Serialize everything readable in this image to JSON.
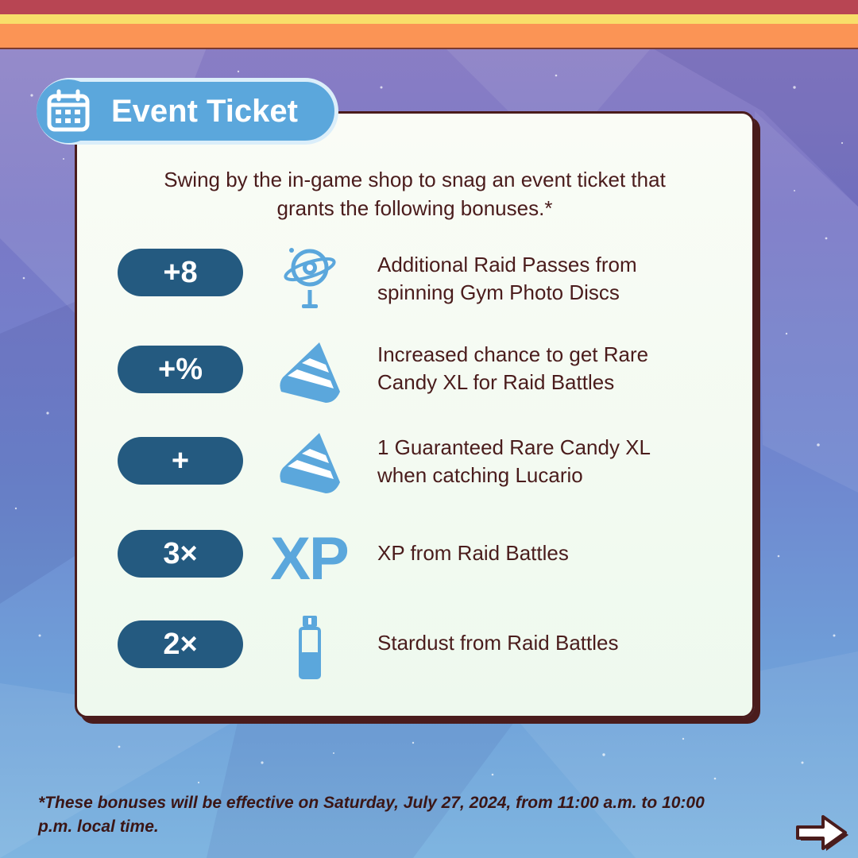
{
  "header": {
    "title": "Event Ticket",
    "icon": "calendar-icon"
  },
  "intro_text": "Swing by the in-game shop to snag an event ticket that grants the following bonuses.*",
  "bonuses": [
    {
      "value": "+8",
      "icon": "raid-pass-icon",
      "text": "Additional Raid Passes from spinning Gym Photo Discs"
    },
    {
      "value": "+%",
      "icon": "rare-candy-xl-icon",
      "text": "Increased chance to get Rare Candy XL for Raid Battles"
    },
    {
      "value": "+",
      "icon": "rare-candy-xl-icon",
      "text": "1 Guaranteed Rare Candy XL when catching Lucario"
    },
    {
      "value": "3×",
      "icon": "xp-icon",
      "icon_label": "XP",
      "text": "XP from Raid Battles"
    },
    {
      "value": "2×",
      "icon": "stardust-icon",
      "text": "Stardust from Raid Battles"
    }
  ],
  "footnote": "*These bonuses will be effective on Saturday, July 27, 2024, from 11:00 a.m. to 10:00 p.m. local time.",
  "next_icon": "arrow-right-icon",
  "colors": {
    "pill": "#245a80",
    "icon_blue": "#5ba7dc",
    "text_dark": "#4a1c1c",
    "stripe_red": "#b84553",
    "stripe_yellow": "#f8de6a",
    "stripe_orange": "#fb9455"
  }
}
